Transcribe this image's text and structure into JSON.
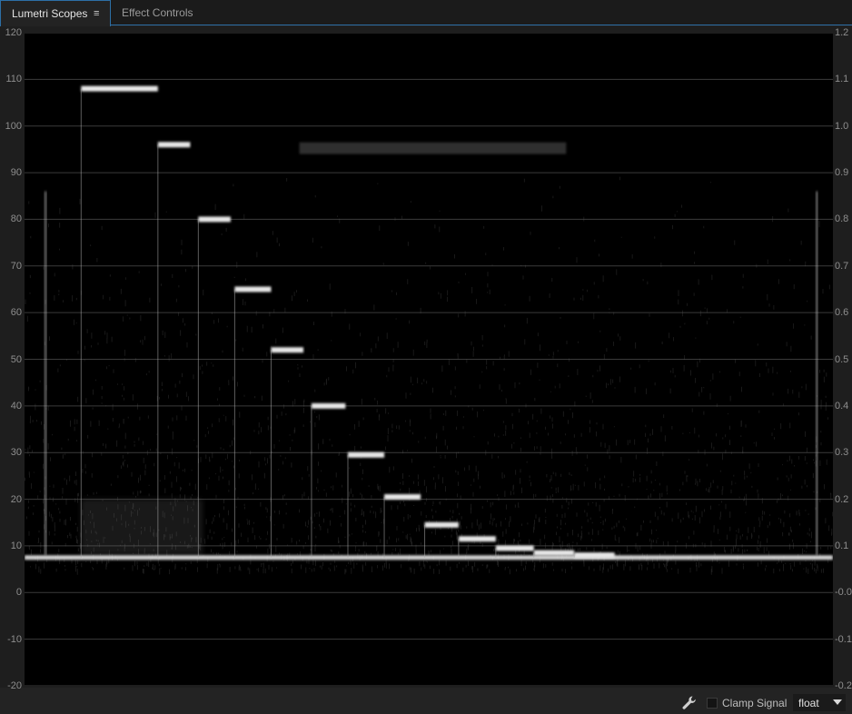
{
  "tabs": [
    {
      "label": "Lumetri Scopes",
      "active": true
    },
    {
      "label": "Effect Controls",
      "active": false
    }
  ],
  "tab_menu_icon": "hamburger-menu-icon",
  "scope": {
    "type": "waveform",
    "left_axis": {
      "ticks": [
        "120",
        "110",
        "100",
        "90",
        "80",
        "70",
        "60",
        "50",
        "40",
        "30",
        "20",
        "10",
        "0",
        "-10",
        "-20"
      ]
    },
    "right_axis": {
      "ticks": [
        "1.2",
        "1.1",
        "1.0",
        "0.9",
        "0.8",
        "0.7",
        "0.6",
        "0.5",
        "0.4",
        "0.3",
        "0.2",
        "0.1",
        "-0.0",
        "-0.1",
        "-0.2"
      ]
    },
    "gridlines": true,
    "steps": [
      {
        "x_start": 0.07,
        "x_end": 0.165,
        "level": 108
      },
      {
        "x_start": 0.165,
        "x_end": 0.205,
        "level": 96
      },
      {
        "x_start": 0.215,
        "x_end": 0.255,
        "level": 80
      },
      {
        "x_start": 0.26,
        "x_end": 0.305,
        "level": 65
      },
      {
        "x_start": 0.305,
        "x_end": 0.345,
        "level": 52
      },
      {
        "x_start": 0.355,
        "x_end": 0.397,
        "level": 40
      },
      {
        "x_start": 0.4,
        "x_end": 0.445,
        "level": 29.5
      },
      {
        "x_start": 0.445,
        "x_end": 0.49,
        "level": 20.5
      },
      {
        "x_start": 0.495,
        "x_end": 0.537,
        "level": 14.5
      },
      {
        "x_start": 0.537,
        "x_end": 0.583,
        "level": 11.5
      },
      {
        "x_start": 0.583,
        "x_end": 0.63,
        "level": 9.5
      },
      {
        "x_start": 0.63,
        "x_end": 0.68,
        "level": 8.5
      },
      {
        "x_start": 0.68,
        "x_end": 0.73,
        "level": 8
      }
    ],
    "baseline_level": 7.5,
    "data_color": "#e8e8e8"
  },
  "bottombar": {
    "wrench_icon": "wrench-icon",
    "clamp_label": "Clamp Signal",
    "clamp_checked": false,
    "float_value": "float"
  }
}
